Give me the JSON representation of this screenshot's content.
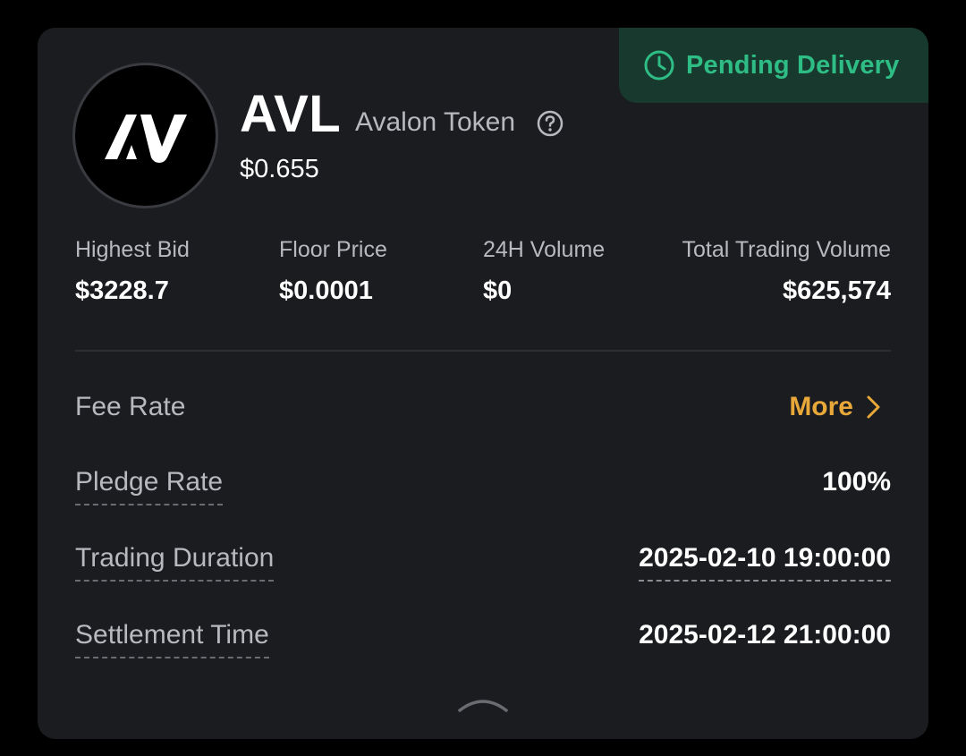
{
  "status": {
    "label": "Pending Delivery",
    "icon": "clock-icon",
    "color": "#2ebd85"
  },
  "token": {
    "ticker": "AVL",
    "name": "Avalon Token",
    "price": "$0.655",
    "logo_icon": "avalon-logo"
  },
  "stats": [
    {
      "label": "Highest Bid",
      "value": "$3228.7"
    },
    {
      "label": "Floor Price",
      "value": "$0.0001"
    },
    {
      "label": "24H Volume",
      "value": "$0"
    },
    {
      "label": "Total Trading Volume",
      "value": "$625,574"
    }
  ],
  "details": {
    "fee_rate": {
      "label": "Fee Rate",
      "link": "More"
    },
    "pledge_rate": {
      "label": "Pledge Rate",
      "value": "100%"
    },
    "trading_duration": {
      "label": "Trading Duration",
      "value": "2025-02-10 19:00:00"
    },
    "settlement_time": {
      "label": "Settlement Time",
      "value": "2025-02-12 21:00:00"
    }
  },
  "colors": {
    "background": "#000000",
    "card": "#1b1c20",
    "accent": "#e8a93a",
    "success": "#2ebd85"
  },
  "controls": {
    "collapse_icon": "chevron-up-icon"
  }
}
